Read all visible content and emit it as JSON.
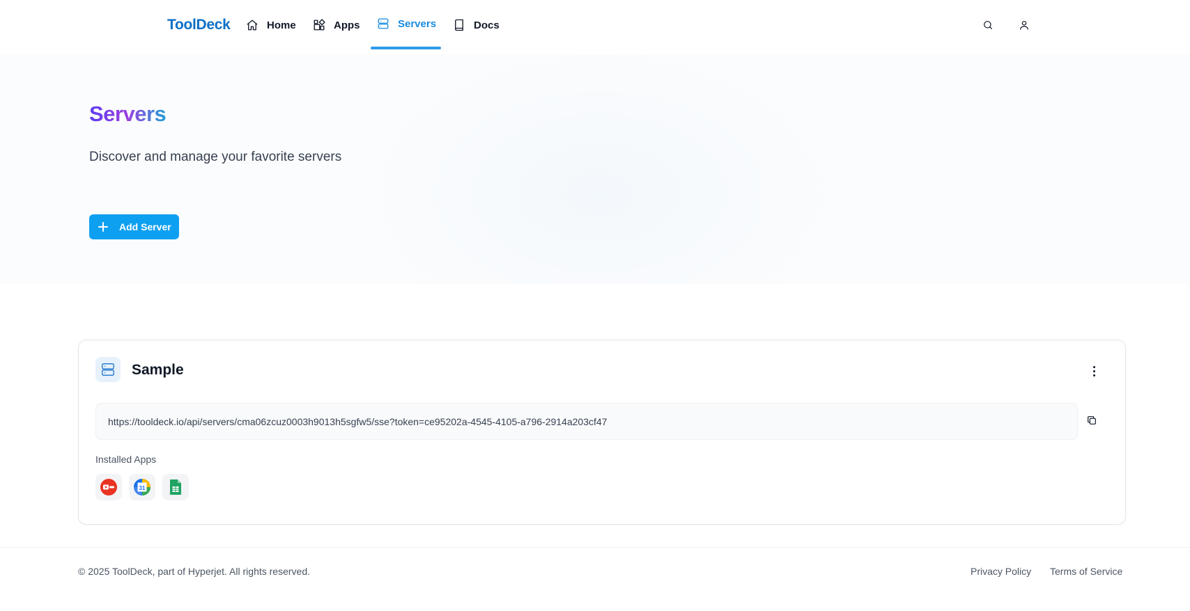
{
  "nav": {
    "brand": "ToolDeck",
    "items": [
      {
        "label": "Home",
        "icon": "home-icon",
        "active": false
      },
      {
        "label": "Apps",
        "icon": "apps-icon",
        "active": false
      },
      {
        "label": "Servers",
        "icon": "server-icon",
        "active": true
      },
      {
        "label": "Docs",
        "icon": "book-icon",
        "active": false
      }
    ],
    "right_icons": [
      "search-icon",
      "user-icon"
    ],
    "accent_color": "#1a8be0"
  },
  "hero": {
    "title": "Servers",
    "subtitle": "Discover and manage your favorite servers",
    "add_button_label": "Add Server"
  },
  "server_card": {
    "name": "Sample",
    "url": "https://tooldeck.io/api/servers/cma06zcuz0003h9013h5sgfw5/sse?token=ce95202a-4545-4105-a796-2914a203cf47",
    "installed_apps_label": "Installed Apps",
    "installed_apps": [
      {
        "icon": "youtube-icon"
      },
      {
        "icon": "google-calendar-icon"
      },
      {
        "icon": "google-sheets-icon"
      }
    ]
  },
  "footer": {
    "copyright": "© 2025 ToolDeck, part of Hyperjet. All rights reserved.",
    "links": [
      "Privacy Policy",
      "Terms of Service"
    ]
  }
}
